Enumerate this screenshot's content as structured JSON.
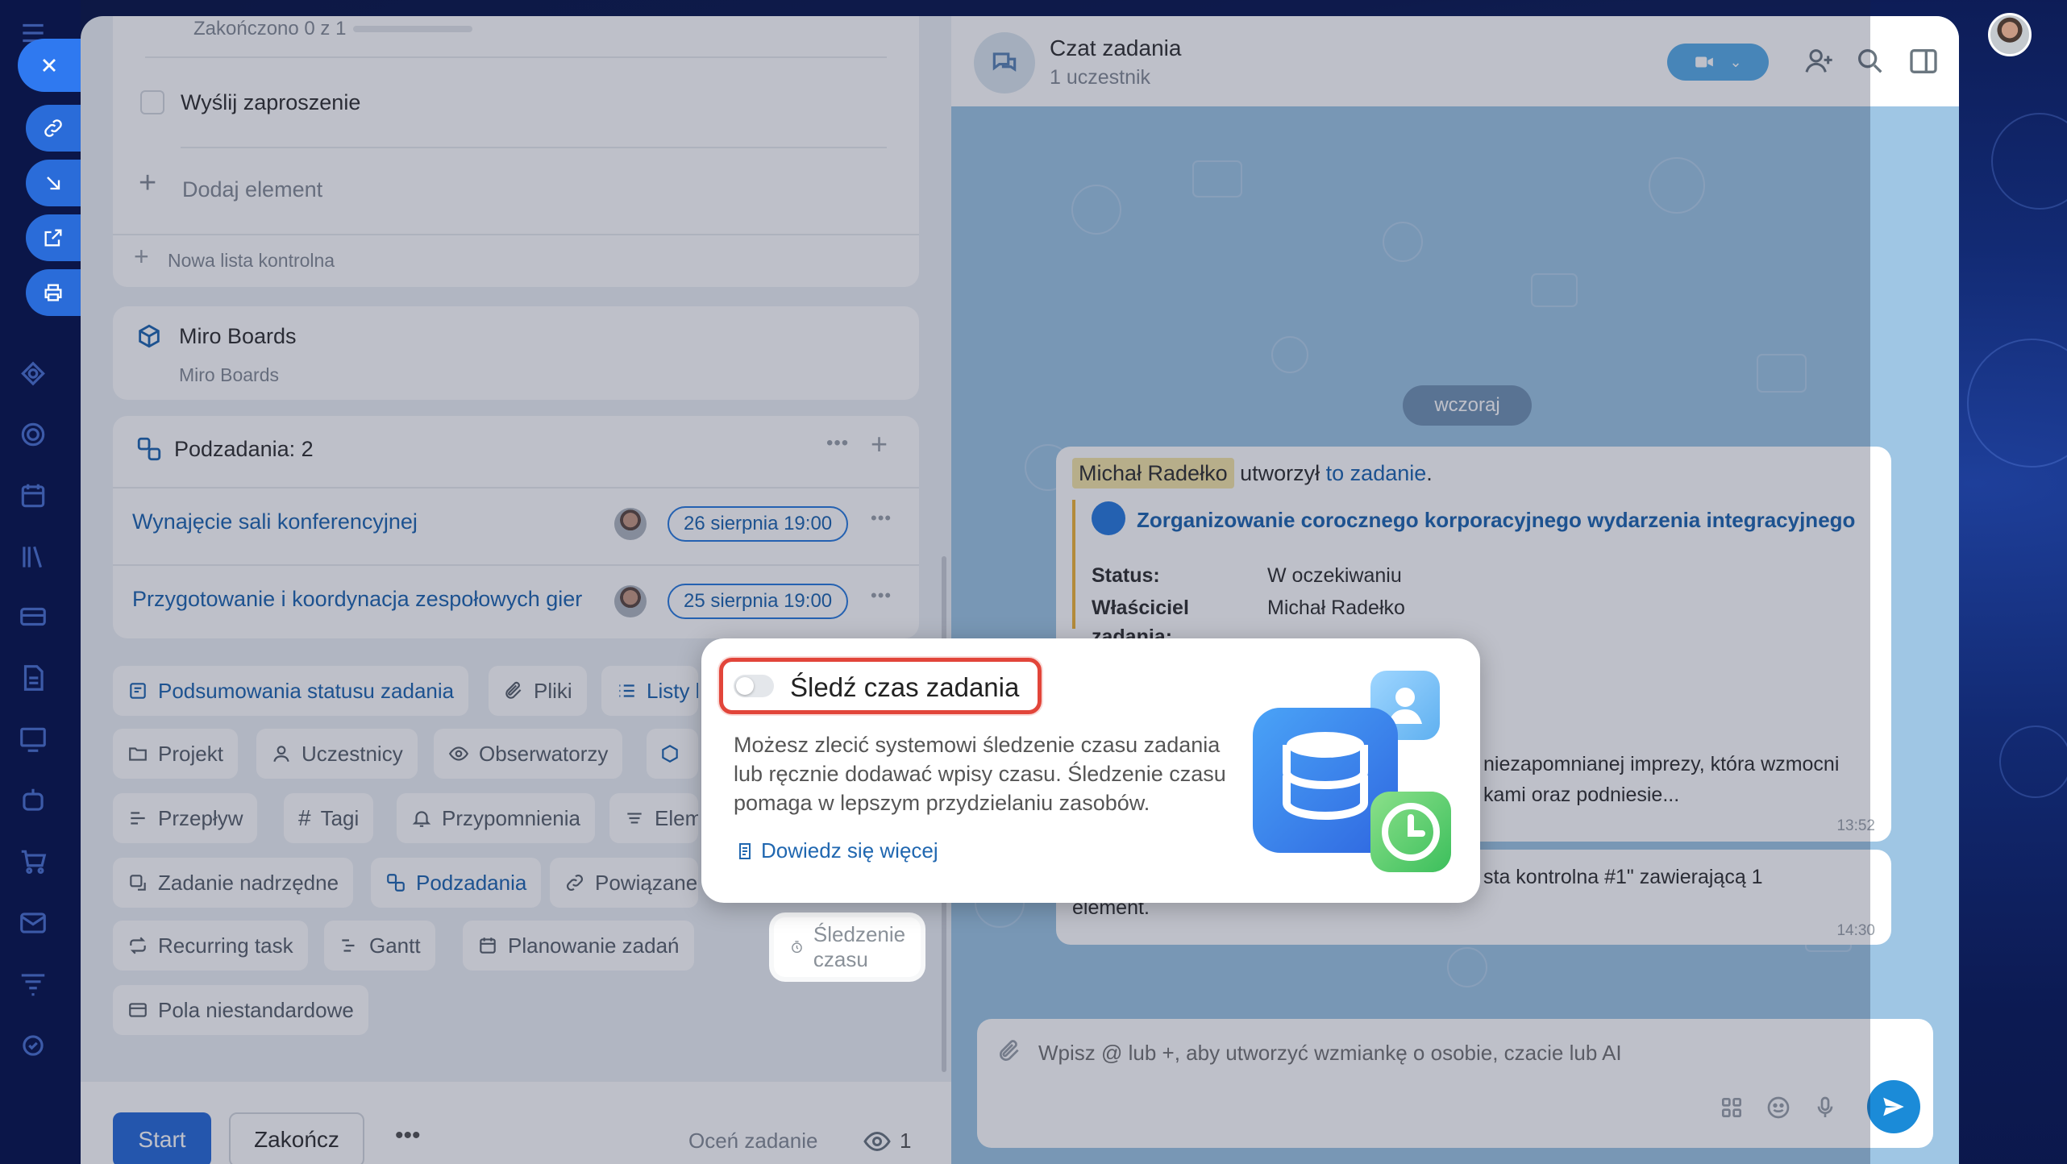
{
  "task": {
    "checklist": {
      "completed_text": "Zakończono 0 z 1",
      "item": "Wyślij zaproszenie",
      "add_item": "Dodaj element",
      "new_checklist": "Nowa lista kontrolna"
    },
    "miro": {
      "title": "Miro Boards",
      "subtitle": "Miro Boards"
    },
    "subtasks": {
      "title": "Podzadania: 2",
      "items": [
        {
          "name": "Wynajęcie sali konferencyjnej",
          "date": "26 sierpnia 19:00"
        },
        {
          "name": "Przygotowanie i koordynacja zespołowych gier",
          "date": "25 sierpnia 19:00"
        }
      ]
    },
    "chips": {
      "status_summary": "Podsumowania statusu zadania",
      "files": "Pliki",
      "lists": "Listy k",
      "project": "Projekt",
      "participants": "Uczestnicy",
      "observers": "Obserwatorzy",
      "flow": "Przepływ",
      "tags": "Tagi",
      "reminders": "Przypomnienia",
      "elements": "Elem",
      "parent_task": "Zadanie nadrzędne",
      "subtasks": "Podzadania",
      "related": "Powiązane",
      "recurring": "Recurring task",
      "gantt": "Gantt",
      "planning": "Planowanie zadań",
      "time_tracking": "Śledzenie czasu",
      "custom_fields": "Pola niestandardowe"
    },
    "bottom": {
      "start": "Start",
      "finish": "Zakończ",
      "more": "•••",
      "rate": "Oceń zadanie",
      "views": "1"
    }
  },
  "chat": {
    "title": "Czat zadania",
    "subtitle": "1 uczestnik",
    "date_badge": "wczoraj",
    "message1": {
      "author": "Michał Radełko",
      "action": "utworzył",
      "link": "to zadanie",
      "task_title": "Zorganizowanie corocznego korporacyjnego wydarzenia integracyjnego",
      "status_label": "Status:",
      "status_value": "W oczekiwaniu",
      "owner_label": "Właściciel",
      "owner_label_2": "zadania:",
      "owner_value": "Michał Radełko",
      "snippet_1": "niezapomnianej imprezy, która wzmocni",
      "snippet_2": "kami oraz podniesie...",
      "time": "13:52"
    },
    "message2": {
      "text_1": "sta kontrolna #1\" zawierającą 1",
      "text_2": "element.",
      "time": "14:30"
    },
    "input_placeholder": "Wpisz @ lub +, aby utworzyć wzmiankę o osobie, czacie lub AI"
  },
  "popup": {
    "title": "Śledź czas zadania",
    "description": "Możesz zlecić systemowi śledzenie czasu zadania lub ręcznie dodawać wpisy czasu. Śledzenie czasu pomaga w lepszym przydzielaniu zasobów.",
    "link": "Dowiedz się więcej",
    "toggle_on": false
  },
  "colors": {
    "accent": "#2a6cd9",
    "link": "#2067b0",
    "highlight_border": "#e2453a",
    "chat_bg": "#9fc6e4"
  }
}
